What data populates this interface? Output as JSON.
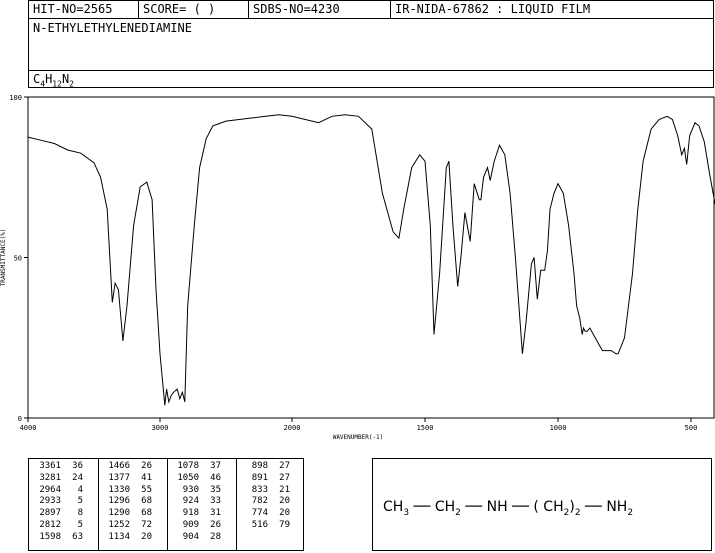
{
  "header": {
    "hit_no": "HIT-NO=2565",
    "score": "SCORE=  (   )",
    "sdbs_no": "SDBS-NO=4230",
    "ir_nida": "IR-NIDA-67862 : LIQUID FILM"
  },
  "compound_name": "N-ETHYLETHYLENEDIAMINE",
  "formula": {
    "c": "C",
    "c_n": "4",
    "h": "H",
    "h_n": "12",
    "n": "N",
    "n_n": "2"
  },
  "structure": {
    "ch3": "CH",
    "ch3_sub": "3",
    "ch2": "CH",
    "ch2_sub": "2",
    "nh": "NH",
    "paren_ch2": "( CH",
    "paren_sub": "2",
    "paren_close": ")",
    "paren_n": "2",
    "nh2": "NH",
    "nh2_sub": "2"
  },
  "chart_data": {
    "type": "line",
    "xlabel": "WAVENUMBER(-1)",
    "ylabel": "TRANSMITTANCE(%)",
    "xlim": [
      4000,
      400
    ],
    "ylim": [
      0,
      100
    ],
    "x_ticks": [
      4000,
      3000,
      2000,
      1500,
      1000,
      500
    ],
    "y_ticks": [
      0,
      50,
      100
    ],
    "series": [
      {
        "points": [
          [
            4000,
            87.5
          ],
          [
            3900,
            86.5
          ],
          [
            3800,
            85.5
          ],
          [
            3700,
            83.5
          ],
          [
            3600,
            82.5
          ],
          [
            3500,
            79.5
          ],
          [
            3450,
            75
          ],
          [
            3400,
            65
          ],
          [
            3361,
            36
          ],
          [
            3340,
            42
          ],
          [
            3315,
            40
          ],
          [
            3281,
            24
          ],
          [
            3250,
            35
          ],
          [
            3200,
            60
          ],
          [
            3150,
            72
          ],
          [
            3100,
            73.5
          ],
          [
            3060,
            68
          ],
          [
            3030,
            40
          ],
          [
            3000,
            20
          ],
          [
            2964,
            4
          ],
          [
            2950,
            9
          ],
          [
            2933,
            5
          ],
          [
            2915,
            7
          ],
          [
            2897,
            8
          ],
          [
            2870,
            9
          ],
          [
            2850,
            6
          ],
          [
            2830,
            8
          ],
          [
            2812,
            5
          ],
          [
            2790,
            35
          ],
          [
            2740,
            60
          ],
          [
            2700,
            78
          ],
          [
            2650,
            87
          ],
          [
            2600,
            91
          ],
          [
            2500,
            92.5
          ],
          [
            2400,
            93
          ],
          [
            2300,
            93.5
          ],
          [
            2200,
            94
          ],
          [
            2100,
            94.5
          ],
          [
            2000,
            94
          ],
          [
            1950,
            93
          ],
          [
            1900,
            92
          ],
          [
            1850,
            94
          ],
          [
            1800,
            94.5
          ],
          [
            1750,
            94
          ],
          [
            1700,
            90
          ],
          [
            1660,
            70
          ],
          [
            1620,
            58
          ],
          [
            1598,
            56
          ],
          [
            1580,
            65
          ],
          [
            1550,
            78
          ],
          [
            1520,
            82
          ],
          [
            1500,
            80
          ],
          [
            1480,
            60
          ],
          [
            1466,
            26
          ],
          [
            1445,
            45
          ],
          [
            1420,
            78
          ],
          [
            1410,
            80
          ],
          [
            1395,
            60
          ],
          [
            1377,
            41
          ],
          [
            1365,
            50
          ],
          [
            1350,
            64
          ],
          [
            1330,
            55
          ],
          [
            1315,
            73
          ],
          [
            1296,
            68
          ],
          [
            1290,
            68
          ],
          [
            1280,
            75
          ],
          [
            1265,
            78
          ],
          [
            1255,
            74
          ],
          [
            1240,
            80
          ],
          [
            1220,
            85
          ],
          [
            1200,
            82
          ],
          [
            1180,
            70
          ],
          [
            1160,
            50
          ],
          [
            1134,
            20
          ],
          [
            1120,
            30
          ],
          [
            1100,
            48
          ],
          [
            1090,
            50
          ],
          [
            1078,
            37
          ],
          [
            1065,
            46
          ],
          [
            1050,
            46
          ],
          [
            1040,
            52
          ],
          [
            1030,
            65
          ],
          [
            1015,
            70
          ],
          [
            1000,
            73
          ],
          [
            980,
            70
          ],
          [
            960,
            60
          ],
          [
            940,
            45
          ],
          [
            930,
            35
          ],
          [
            924,
            33
          ],
          [
            918,
            31
          ],
          [
            909,
            26
          ],
          [
            904,
            28
          ],
          [
            898,
            27
          ],
          [
            891,
            27
          ],
          [
            880,
            28
          ],
          [
            860,
            25
          ],
          [
            833,
            21
          ],
          [
            800,
            21
          ],
          [
            782,
            20
          ],
          [
            774,
            20
          ],
          [
            750,
            25
          ],
          [
            720,
            45
          ],
          [
            700,
            65
          ],
          [
            680,
            80
          ],
          [
            650,
            90
          ],
          [
            620,
            93
          ],
          [
            590,
            94
          ],
          [
            570,
            93
          ],
          [
            550,
            88
          ],
          [
            535,
            82
          ],
          [
            525,
            84
          ],
          [
            516,
            79
          ],
          [
            505,
            88
          ],
          [
            485,
            92
          ],
          [
            470,
            91
          ],
          [
            450,
            86
          ],
          [
            430,
            76
          ],
          [
            410,
            67
          ],
          [
            400,
            64
          ]
        ]
      }
    ]
  },
  "peak_columns": [
    [
      [
        "3361",
        "36"
      ],
      [
        "3281",
        "24"
      ],
      [
        "2964",
        "4"
      ],
      [
        "2933",
        "5"
      ],
      [
        "2897",
        "8"
      ],
      [
        "2812",
        "5"
      ],
      [
        "1598",
        "63"
      ]
    ],
    [
      [
        "1466",
        "26"
      ],
      [
        "1377",
        "41"
      ],
      [
        "1330",
        "55"
      ],
      [
        "1296",
        "68"
      ],
      [
        "1290",
        "68"
      ],
      [
        "1252",
        "72"
      ],
      [
        "1134",
        "20"
      ]
    ],
    [
      [
        "1078",
        "37"
      ],
      [
        "1050",
        "46"
      ],
      [
        "930",
        "35"
      ],
      [
        "924",
        "33"
      ],
      [
        "918",
        "31"
      ],
      [
        "909",
        "26"
      ],
      [
        "904",
        "28"
      ]
    ],
    [
      [
        "898",
        "27"
      ],
      [
        "891",
        "27"
      ],
      [
        "833",
        "21"
      ],
      [
        "782",
        "20"
      ],
      [
        "774",
        "20"
      ],
      [
        "516",
        "79"
      ]
    ]
  ]
}
